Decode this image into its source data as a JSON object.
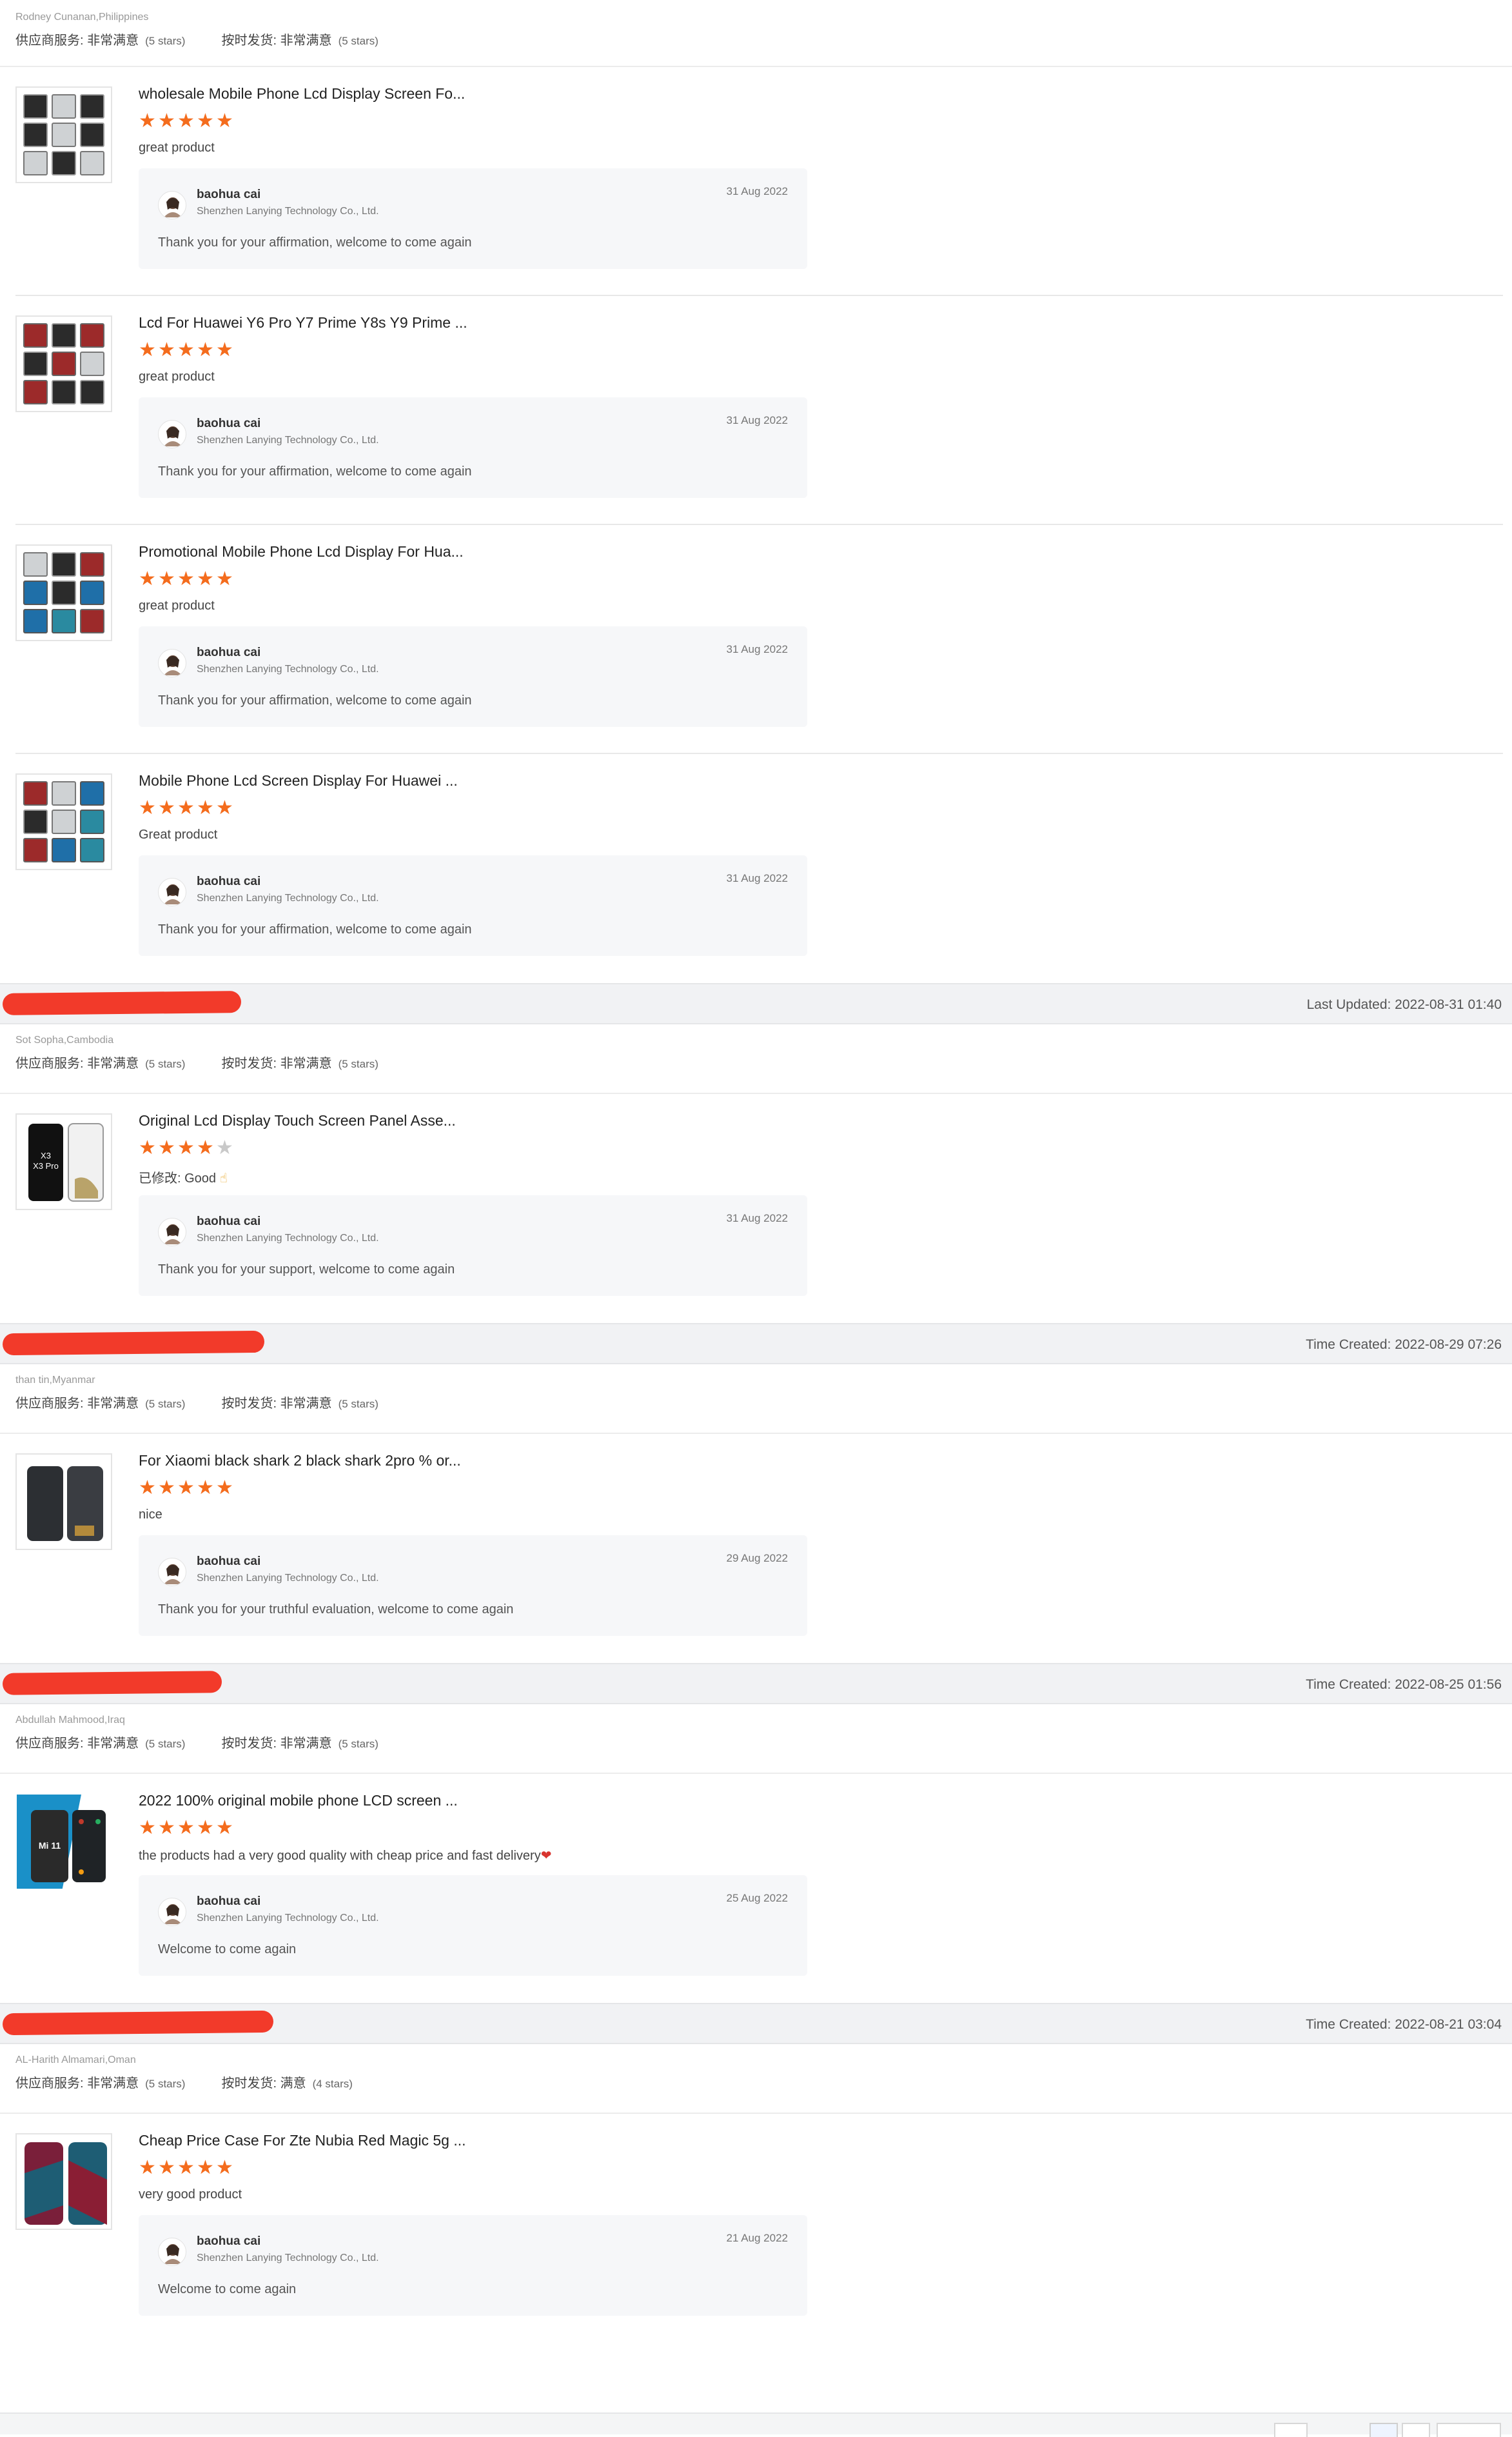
{
  "labels": {
    "supplier_service": "供应商服务:",
    "on_time": "按时发货:"
  },
  "reply_template": {
    "name": "baohua cai",
    "company": "Shenzhen Lanying Technology Co., Ltd."
  },
  "first_buyer": {
    "name": "Rodney Cunanan,Philippines",
    "supplier_value": "非常满意",
    "supplier_stars": "(5 stars)",
    "ontime_value": "非常满意",
    "ontime_stars": "(5 stars)"
  },
  "items": [
    {
      "title": "wholesale Mobile Phone Lcd Display Screen Fo...",
      "rating": 5,
      "text": "great product",
      "reply_date": "31 Aug 2022",
      "reply_msg": "Thank you for your affirmation, welcome to come again"
    },
    {
      "title": "Lcd For Huawei Y6 Pro Y7 Prime Y8s Y9 Prime ...",
      "rating": 5,
      "text": "great product",
      "reply_date": "31 Aug 2022",
      "reply_msg": "Thank you for your affirmation, welcome to come again"
    },
    {
      "title": "Promotional Mobile Phone Lcd Display For Hua...",
      "rating": 5,
      "text": "great product",
      "reply_date": "31 Aug 2022",
      "reply_msg": "Thank you for your affirmation, welcome to come again"
    },
    {
      "title": "Mobile Phone Lcd Screen Display For Huawei ...",
      "rating": 5,
      "text": "Great product",
      "reply_date": "31 Aug 2022",
      "reply_msg": "Thank you for your affirmation, welcome to come again"
    }
  ],
  "orders": [
    {
      "time": "Last Updated: 2022-08-31 01:40",
      "buyer": "Sot Sopha,Cambodia",
      "supplier_value": "非常满意",
      "supplier_stars": "(5 stars)",
      "ontime_value": "非常满意",
      "ontime_stars": "(5 stars)",
      "title": "Original Lcd Display Touch Screen Panel Asse...",
      "rating": 4,
      "text": "已修改: Good",
      "reply_date": "31 Aug 2022",
      "reply_msg": "Thank you for your support, welcome to come again",
      "thumb_label_1": "X3",
      "thumb_label_2": "X3 Pro"
    },
    {
      "time": "Time Created: 2022-08-29 07:26",
      "buyer": "than tin,Myanmar",
      "supplier_value": "非常满意",
      "supplier_stars": "(5 stars)",
      "ontime_value": "非常满意",
      "ontime_stars": "(5 stars)",
      "title": "For Xiaomi black shark 2 black shark 2pro % or...",
      "rating": 5,
      "text": "nice",
      "reply_date": "29 Aug 2022",
      "reply_msg": "Thank you for your truthful evaluation, welcome to come again"
    },
    {
      "time": "Time Created: 2022-08-25 01:56",
      "buyer": "Abdullah Mahmood,Iraq",
      "supplier_value": "非常满意",
      "supplier_stars": "(5 stars)",
      "ontime_value": "非常满意",
      "ontime_stars": "(5 stars)",
      "title": "2022 100% original mobile phone LCD screen ...",
      "rating": 5,
      "text": "the products had a very good quality with cheap price and fast delivery",
      "reply_date": "25 Aug 2022",
      "reply_msg": "Welcome to come again",
      "thumb_label_1": "Mi 11"
    },
    {
      "time": "Time Created: 2022-08-21 03:04",
      "buyer": "AL-Harith Almamari,Oman",
      "supplier_value": "非常满意",
      "supplier_stars": "(5 stars)",
      "ontime_value": "满意",
      "ontime_stars": "(4 stars)",
      "title": "Cheap Price Case For Zte Nubia Red Magic 5g ...",
      "rating": 5,
      "text": "very good product",
      "reply_date": "21 Aug 2022",
      "reply_msg": "Welcome to come again"
    }
  ],
  "colors": {
    "star_on": "#f46c1d",
    "star_off": "#c9c9c9",
    "redaction": "#f23a2a"
  }
}
